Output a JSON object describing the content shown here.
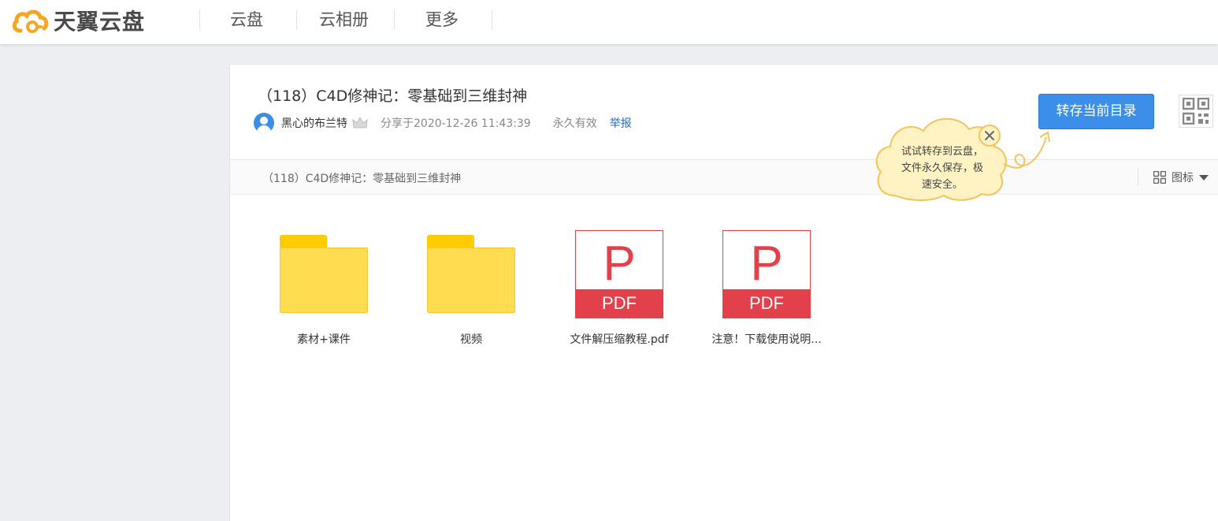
{
  "header": {
    "logo_text": "天翼云盘",
    "nav": [
      "云盘",
      "云相册",
      "更多"
    ]
  },
  "share": {
    "title": "（118）C4D修神记：零基础到三维封神",
    "author": "黑心的布兰特",
    "shared_at": "分享于2020-12-26 11:43:39",
    "validity": "永久有效",
    "report_label": "举报",
    "save_button_label": "转存当前目录"
  },
  "toolbar": {
    "breadcrumb": "（118）C4D修神记：零基础到三维封神",
    "view_label": "图标"
  },
  "tooltip": {
    "lines": [
      "试试转存到云盘，",
      "文件永久保存，极",
      "速安全。"
    ]
  },
  "files": [
    {
      "name": "素材+课件",
      "type": "folder"
    },
    {
      "name": "视频",
      "type": "folder"
    },
    {
      "name": "文件解压缩教程.pdf",
      "type": "pdf"
    },
    {
      "name": "注意！下载使用说明...",
      "type": "pdf"
    }
  ],
  "pdf_icon": {
    "letter": "P",
    "band": "PDF"
  },
  "colors": {
    "accent_blue": "#3b8fe8",
    "logo_orange": "#f5a623",
    "folder_yellow": "#ffdc50",
    "pdf_red": "#e2404a",
    "tooltip_bg": "#fff3c4",
    "tooltip_border": "#f5c35a"
  }
}
